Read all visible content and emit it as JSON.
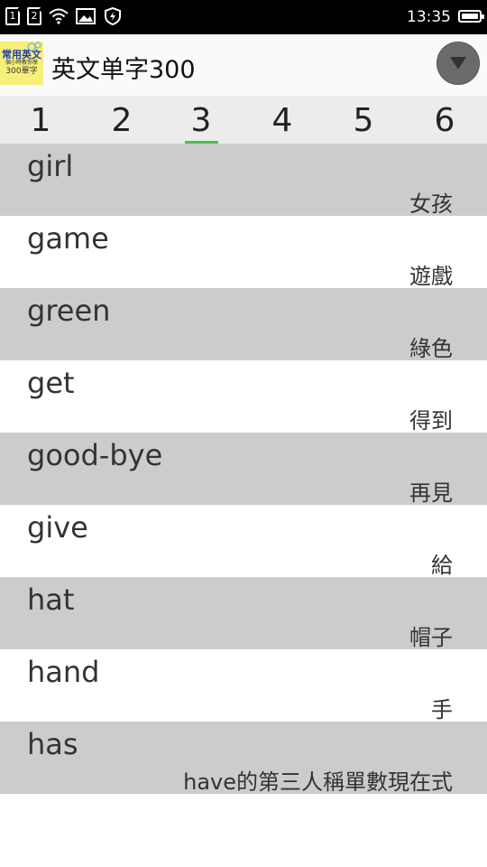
{
  "status_bar": {
    "sim1": "1",
    "sim2": "2",
    "time": "13:35",
    "icons": [
      "sim-1-icon",
      "sim-2-icon",
      "wifi-icon",
      "image-icon",
      "shield-icon",
      "battery-icon"
    ]
  },
  "app_bar": {
    "title": "英文单字300",
    "logo": {
      "line1": "常用英文",
      "line2": "個小時教你學",
      "line3": "300單字"
    },
    "menu_icon": "dropdown-arrow-icon"
  },
  "tabs": [
    {
      "label": "1",
      "active": false
    },
    {
      "label": "2",
      "active": false
    },
    {
      "label": "3",
      "active": true
    },
    {
      "label": "4",
      "active": false
    },
    {
      "label": "5",
      "active": false
    },
    {
      "label": "6",
      "active": false
    }
  ],
  "words": [
    {
      "word": "girl",
      "meaning": "女孩"
    },
    {
      "word": "game",
      "meaning": "遊戲"
    },
    {
      "word": "green",
      "meaning": "綠色"
    },
    {
      "word": "get",
      "meaning": "得到"
    },
    {
      "word": "good-bye",
      "meaning": "再見"
    },
    {
      "word": "give",
      "meaning": "給"
    },
    {
      "word": "hat",
      "meaning": "帽子"
    },
    {
      "word": "hand",
      "meaning": "手"
    },
    {
      "word": "has",
      "meaning": "have的第三人稱單數現在式"
    }
  ],
  "colors": {
    "tab_indicator": "#4cc04c",
    "row_alt": "#cccccc",
    "tab_bar": "#ececec"
  }
}
